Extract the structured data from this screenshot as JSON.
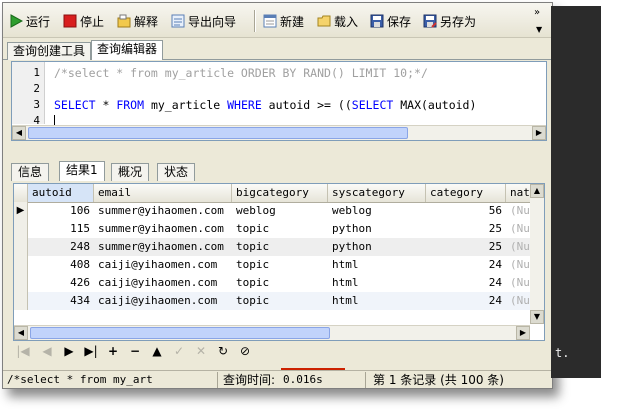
{
  "toolbar": {
    "run": "运行",
    "stop": "停止",
    "explain": "解释",
    "export_wizard": "导出向导",
    "new": "新建",
    "load": "载入",
    "save": "保存",
    "save_as": "另存为"
  },
  "top_tabs": [
    "查询创建工具",
    "查询编辑器"
  ],
  "editor": {
    "line_numbers": [
      "1",
      "2",
      "3",
      "4"
    ],
    "line1": "/*select * from my_article ORDER BY RAND() LIMIT 10;*/",
    "line3_kw1": "SELECT",
    "line3_t1": " * ",
    "line3_kw2": "FROM",
    "line3_t2": " my_article ",
    "line3_kw3": "WHERE",
    "line3_t3": " autoid >= ((",
    "line3_kw4": "SELECT",
    "line3_t4": " MAX(autoid)"
  },
  "result_tabs": [
    "信息",
    "结果1",
    "概况",
    "状态"
  ],
  "grid": {
    "columns": [
      "autoid",
      "email",
      "bigcategory",
      "syscategory",
      "category",
      "nat"
    ],
    "rows": [
      {
        "autoid": "106",
        "email": "summer@yihaomen.com",
        "bigcategory": "weblog",
        "syscategory": "weblog",
        "category": "56",
        "nat": "(Nu"
      },
      {
        "autoid": "115",
        "email": "summer@yihaomen.com",
        "bigcategory": "topic",
        "syscategory": "python",
        "category": "25",
        "nat": "(Nu"
      },
      {
        "autoid": "248",
        "email": "summer@yihaomen.com",
        "bigcategory": "topic",
        "syscategory": "python",
        "category": "25",
        "nat": "(Nu"
      },
      {
        "autoid": "408",
        "email": "caiji@yihaomen.com",
        "bigcategory": "topic",
        "syscategory": "html",
        "category": "24",
        "nat": "(Nu"
      },
      {
        "autoid": "426",
        "email": "caiji@yihaomen.com",
        "bigcategory": "topic",
        "syscategory": "html",
        "category": "24",
        "nat": "(Nu"
      },
      {
        "autoid": "434",
        "email": "caiji@yihaomen.com",
        "bigcategory": "topic",
        "syscategory": "html",
        "category": "24",
        "nat": "(Nu"
      }
    ]
  },
  "status": {
    "query": "/*select * from my_art",
    "time_label": "查询时间:",
    "time_value": "0.016s",
    "record": "第 1 条记录 (共 100 条)"
  },
  "side": {
    "text": "t."
  },
  "colors": {
    "keyword": "#0000ff",
    "comment": "#a0a0a0",
    "selected_header": "#d6e4f7",
    "accent_red": "#cc2200"
  }
}
